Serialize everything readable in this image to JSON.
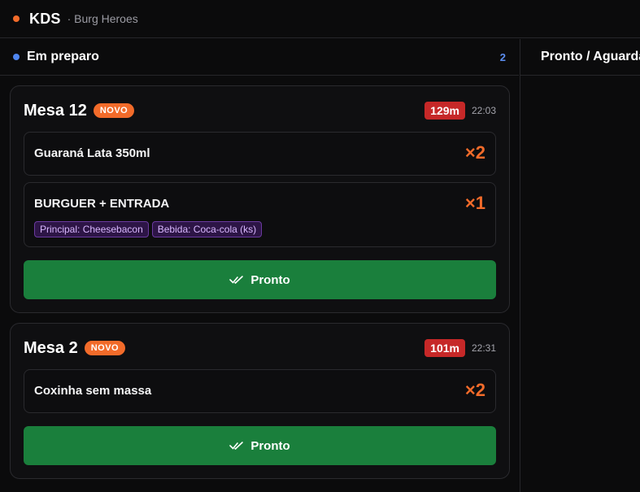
{
  "header": {
    "brand": "KDS",
    "store": "· Burg Heroes",
    "brand_dot_color": "#f26b2a"
  },
  "columns": [
    {
      "title": "Em preparo",
      "count": "2",
      "dot_color": "#4f86f0"
    },
    {
      "title": "Pronto / Aguardando",
      "dot_color": "#2ecc5a"
    }
  ],
  "orders": [
    {
      "table": "Mesa 12",
      "badge": "NOVO",
      "elapsed": "129m",
      "time": "22:03",
      "items": [
        {
          "name": "Guaraná Lata 350ml",
          "qty": "×2"
        },
        {
          "name": "BURGUER + ENTRADA",
          "qty": "×1",
          "modifiers": [
            "Principal: Cheesebacon",
            "Bebida: Coca-cola (ks)"
          ]
        }
      ],
      "action": "Pronto",
      "action_icon": "double-check-icon"
    },
    {
      "table": "Mesa 2",
      "badge": "NOVO",
      "elapsed": "101m",
      "time": "22:31",
      "items": [
        {
          "name": "Coxinha sem massa",
          "qty": "×2"
        }
      ],
      "action": "Pronto",
      "action_icon": "double-check-icon"
    }
  ],
  "colors": {
    "accent": "#f26b2a",
    "late": "#c62828",
    "done": "#1a7f3c",
    "modifier": "#2d1546"
  }
}
